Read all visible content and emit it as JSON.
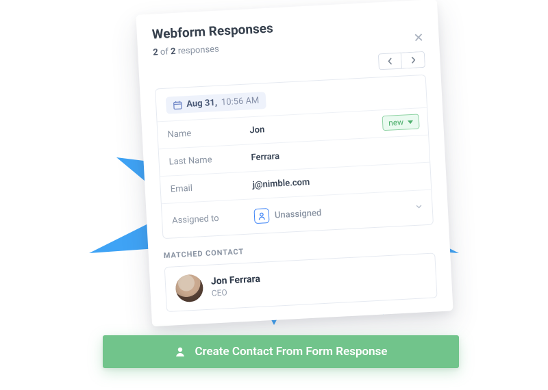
{
  "header": {
    "title": "Webform Responses",
    "count_bold_a": "2",
    "count_mid": " of ",
    "count_bold_b": "2",
    "count_tail": " responses"
  },
  "date_chip": {
    "date": "Aug 31,",
    "time": "10:56 AM"
  },
  "status": {
    "label": "new"
  },
  "fields": {
    "name": {
      "label": "Name",
      "value": "Jon"
    },
    "last_name": {
      "label": "Last Name",
      "value": "Ferrara"
    },
    "email": {
      "label": "Email",
      "value": "j@nimble.com"
    },
    "assigned": {
      "label": "Assigned to",
      "value": "Unassigned"
    }
  },
  "matched": {
    "section_label": "MATCHED CONTACT",
    "name": "Jon Ferrara",
    "role": "CEO"
  },
  "cta": {
    "label": "Create Contact From Form Response"
  }
}
